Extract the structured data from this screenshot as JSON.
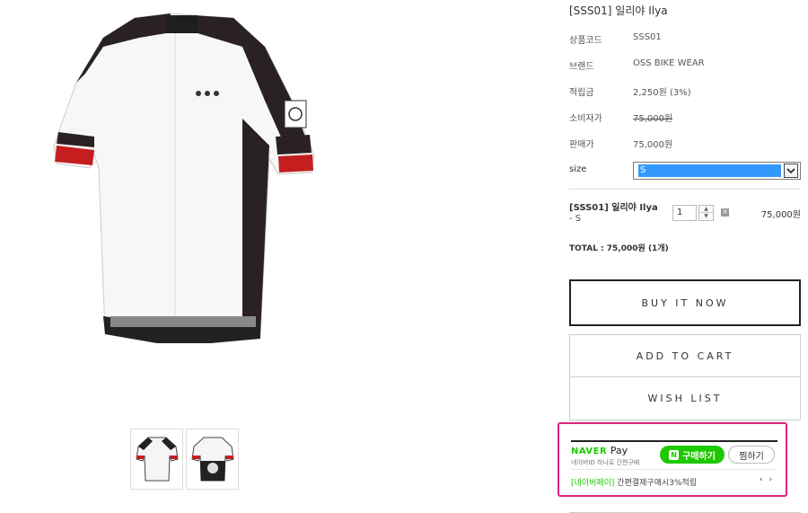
{
  "product": {
    "title": "[SSS01] 일리야 Ilya",
    "specs": [
      {
        "label": "상품코드",
        "value": "SSS01"
      },
      {
        "label": "브랜드",
        "value": "OSS BIKE WEAR"
      },
      {
        "label": "적립금",
        "value": "2,250원 (3%)"
      },
      {
        "label": "소비자가",
        "value": "75,000원"
      },
      {
        "label": "판매가",
        "value": "75,000원"
      }
    ],
    "size_label": "size",
    "size_selected": "S"
  },
  "option": {
    "name": "[SSS01] 일리야 Ilya",
    "sub": "- S",
    "quantity": "1",
    "price": "75,000원"
  },
  "total": {
    "label": "TOTAL : ",
    "amount": "75,000원",
    "count": " (1개)"
  },
  "buttons": {
    "buy_now": "BUY IT NOW",
    "add_to_cart": "ADD TO CART",
    "wish_list": "WISH LIST"
  },
  "npay": {
    "naver": "NAVER",
    "pay": "Pay",
    "sub": "네이버ID 하나로 간편구매",
    "buy_badge": "N",
    "buy_label": "구매하기",
    "wish_label": "찜하기",
    "promo_tag": "[네이버페이]",
    "promo_text": " 간편결제구매시3%적립",
    "nav": "‹ ›"
  },
  "colors": {
    "npay_green": "#1ec800",
    "highlight": "#e0247a",
    "select_blue": "#3399ff"
  }
}
